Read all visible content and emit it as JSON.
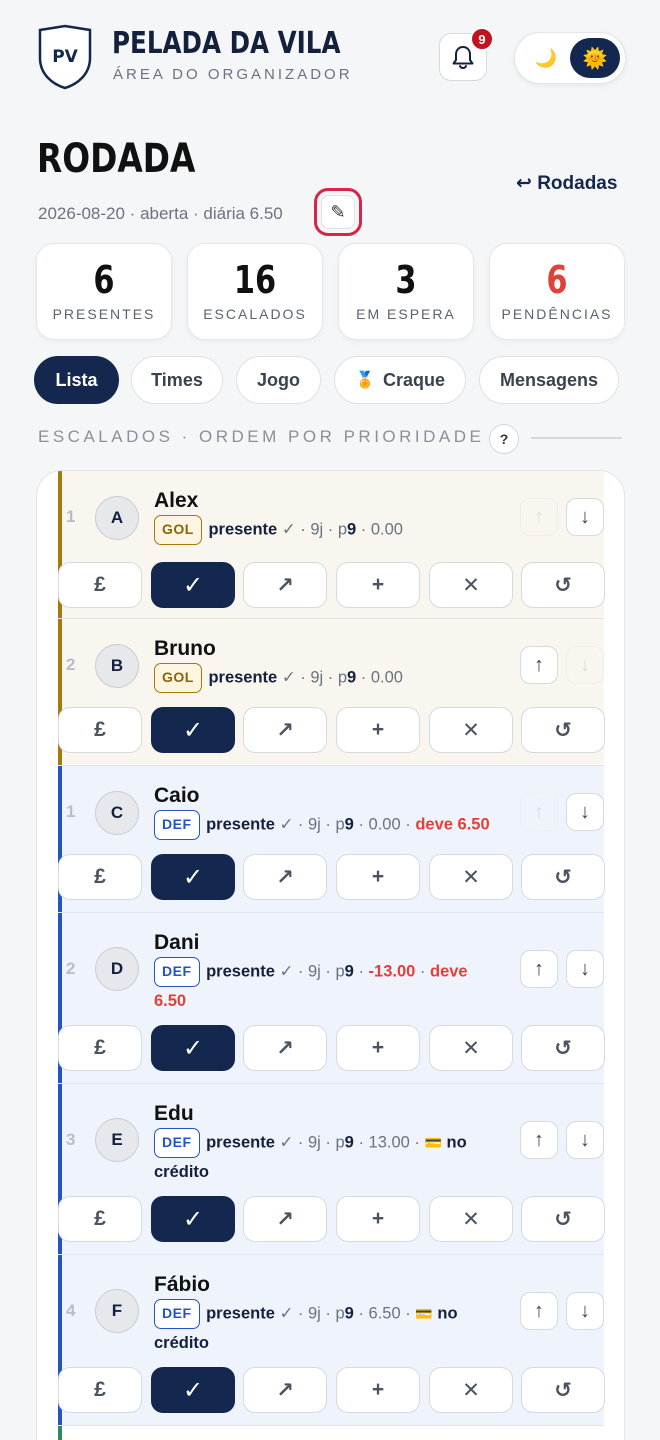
{
  "header": {
    "logo_text": "PV",
    "title": "PELADA DA VILA",
    "subtitle": "ÁREA DO ORGANIZADOR",
    "notification_count": "9",
    "theme_moon": "🌙",
    "theme_sun": "🌞"
  },
  "round": {
    "title": "RODADA",
    "meta": "2026-08-20 · aberta · diária 6.50",
    "edit_icon": "✎",
    "back_link": "↩ Rodadas"
  },
  "stats": [
    {
      "value": "6",
      "label": "PRESENTES"
    },
    {
      "value": "16",
      "label": "ESCALADOS"
    },
    {
      "value": "3",
      "label": "EM ESPERA"
    },
    {
      "value": "6",
      "label": "PENDÊNCIAS"
    }
  ],
  "tabs": [
    {
      "label": "Lista",
      "active": true
    },
    {
      "label": "Times"
    },
    {
      "label": "Jogo"
    },
    {
      "label": "Craque",
      "icon": "🏅"
    },
    {
      "label": "Mensagens"
    }
  ],
  "section": {
    "heading": "ESCALADOS · ORDEM POR PRIORIDADE",
    "help": "?"
  },
  "action_icons": {
    "pay": "£",
    "present": "✓",
    "move": "↗",
    "add": "+",
    "remove": "✕",
    "undo": "↺"
  },
  "arrows": {
    "up": "↑",
    "down": "↓"
  },
  "players": [
    {
      "rank": "1",
      "initial": "A",
      "name": "Alex",
      "position": "GOL",
      "status": "presente",
      "check": "✓",
      "games": "9j",
      "prio_prefix": "p",
      "prio": "9",
      "balance": "0.00"
    },
    {
      "rank": "2",
      "initial": "B",
      "name": "Bruno",
      "position": "GOL",
      "status": "presente",
      "check": "✓",
      "games": "9j",
      "prio_prefix": "p",
      "prio": "9",
      "balance": "0.00"
    },
    {
      "rank": "1",
      "initial": "C",
      "name": "Caio",
      "position": "DEF",
      "status": "presente",
      "check": "✓",
      "games": "9j",
      "prio_prefix": "p",
      "prio": "9",
      "balance": "0.00",
      "owes": "deve 6.50"
    },
    {
      "rank": "2",
      "initial": "D",
      "name": "Dani",
      "position": "DEF",
      "status": "presente",
      "check": "✓",
      "games": "9j",
      "prio_prefix": "p",
      "prio": "9",
      "balance": "-13.00",
      "owes": "deve 6.50"
    },
    {
      "rank": "3",
      "initial": "E",
      "name": "Edu",
      "position": "DEF",
      "status": "presente",
      "check": "✓",
      "games": "9j",
      "prio_prefix": "p",
      "prio": "9",
      "balance": "13.00",
      "credit_icon": "💳",
      "credit": "no crédito"
    },
    {
      "rank": "4",
      "initial": "F",
      "name": "Fábio",
      "position": "DEF",
      "status": "presente",
      "check": "✓",
      "games": "9j",
      "prio_prefix": "p",
      "prio": "9",
      "balance": "6.50",
      "credit_icon": "💳",
      "credit": "no crédito"
    }
  ]
}
